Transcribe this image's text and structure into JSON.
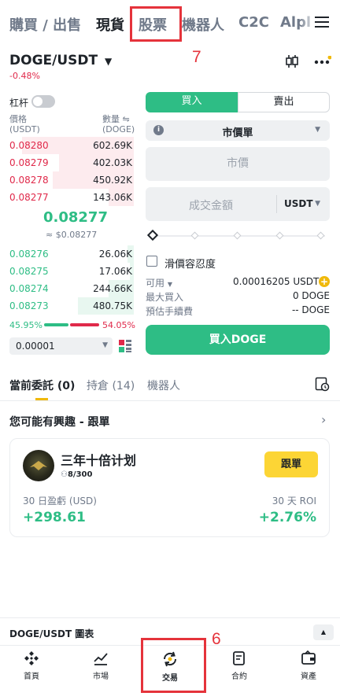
{
  "top_tabs": [
    "購買 / 出售",
    "現貨",
    "股票",
    "機器人",
    "C2C",
    "Alpl"
  ],
  "annotations": {
    "top_tab_marker": "7",
    "bottom_nav_marker": "6"
  },
  "pair": {
    "name": "DOGE/USDT",
    "change": "-0.48%"
  },
  "orderbook": {
    "leverage_label": "杠杆",
    "price_header": "價格",
    "price_unit": "(USDT)",
    "qty_header": "數量 ⇋",
    "qty_unit": "(DOGE)",
    "asks": [
      {
        "price": "0.08280",
        "qty": "602.69K",
        "depth": 0.9
      },
      {
        "price": "0.08279",
        "qty": "402.03K",
        "depth": 0.6
      },
      {
        "price": "0.08278",
        "qty": "450.92K",
        "depth": 0.65
      },
      {
        "price": "0.08277",
        "qty": "143.06K",
        "depth": 0.2
      }
    ],
    "last_price": "0.08277",
    "last_price_usd": "≈ $0.08277",
    "bids": [
      {
        "price": "0.08276",
        "qty": "26.06K",
        "depth": 0.05
      },
      {
        "price": "0.08275",
        "qty": "17.06K",
        "depth": 0.03
      },
      {
        "price": "0.08274",
        "qty": "244.66K",
        "depth": 0.2
      },
      {
        "price": "0.08273",
        "qty": "480.75K",
        "depth": 0.45
      }
    ],
    "buy_ratio": "45.95%",
    "sell_ratio": "54.05%",
    "precision": "0.00001"
  },
  "order_form": {
    "buy_tab": "買入",
    "sell_tab": "賣出",
    "order_type": "市價單",
    "price_placeholder": "市價",
    "amount_placeholder": "成交金額",
    "amount_unit": "USDT",
    "slippage_label": "滑價容忍度",
    "available_label": "可用",
    "available_value": "0.00016205 USDT",
    "max_buy_label": "最大買入",
    "max_buy_value": "0 DOGE",
    "fee_label": "預估手續費",
    "fee_value": "-- DOGE",
    "submit_label": "買入DOGE"
  },
  "bottom_tabs": {
    "current_orders": "當前委託 (0)",
    "positions": "持倉 (14)",
    "bots": "機器人"
  },
  "copy_trade": {
    "section_title": "您可能有興趣 - 跟單",
    "name": "三年十倍计划",
    "followers": "8/300",
    "follow_button": "跟單",
    "pnl_label": "30 日盈虧 (USD)",
    "roi_label": "30 天 ROI",
    "pnl_value": "+298.61",
    "roi_value": "+2.76%"
  },
  "chart_bar": {
    "label": "DOGE/USDT 圖表"
  },
  "nav": [
    {
      "label": "首頁",
      "icon": "home-icon"
    },
    {
      "label": "市場",
      "icon": "market-chart-icon"
    },
    {
      "label": "交易",
      "icon": "trade-exchange-icon"
    },
    {
      "label": "合約",
      "icon": "futures-contract-icon"
    },
    {
      "label": "資產",
      "icon": "wallet-icon"
    }
  ],
  "colors": {
    "green": "#2ebd85",
    "red": "#e0294a",
    "gold": "#f0b90b",
    "annotation": "#e5333b"
  }
}
